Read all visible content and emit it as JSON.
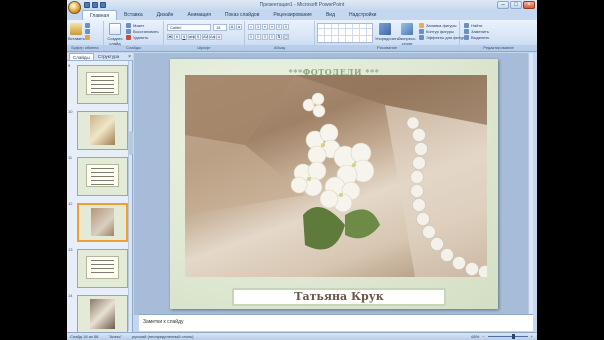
{
  "window": {
    "title": "Презентация1 - Microsoft PowerPoint"
  },
  "ribbon": {
    "tabs": [
      "Главная",
      "Вставка",
      "Дизайн",
      "Анимация",
      "Показ слайдов",
      "Рецензирование",
      "Вид",
      "Надстройки"
    ],
    "clipboard": {
      "paste": "Вставить",
      "cut": "Вырезать",
      "copy": "Копировать",
      "format": "Формат по образцу",
      "label": "Буфер обмена"
    },
    "slides": {
      "new_slide": "Создать слайд",
      "layout": "Макет",
      "reset": "Восстановить",
      "delete": "Удалить",
      "label": "Слайды"
    },
    "font": {
      "name": "Calibri",
      "size": "18",
      "label": "Шрифт"
    },
    "paragraph": {
      "label": "Абзац"
    },
    "drawing": {
      "arrange": "Упорядочить",
      "quick_styles": "Экспресс-стили",
      "fill": "Заливка фигуры",
      "outline": "Контур фигуры",
      "effects": "Эффекты для фигур",
      "label": "Рисование"
    },
    "editing": {
      "find": "Найти",
      "replace": "Заменить",
      "select": "Выделить",
      "label": "Редактирование"
    }
  },
  "panel": {
    "tab_slides": "Слайды",
    "tab_outline": "Структура",
    "close": "×",
    "thumbs": [
      "9",
      "10",
      "11",
      "12",
      "13",
      "14"
    ]
  },
  "slide": {
    "heading": "***ФОТОДЕЛИ ***",
    "author": "Татьяна Крук"
  },
  "notes": {
    "text": "Заметки к слайду"
  },
  "status": {
    "slide_of": "Слайд 18 из 58",
    "theme": "\"Апекс\"",
    "language": "русский (неопределенный стиль)",
    "zoom": "68%"
  }
}
